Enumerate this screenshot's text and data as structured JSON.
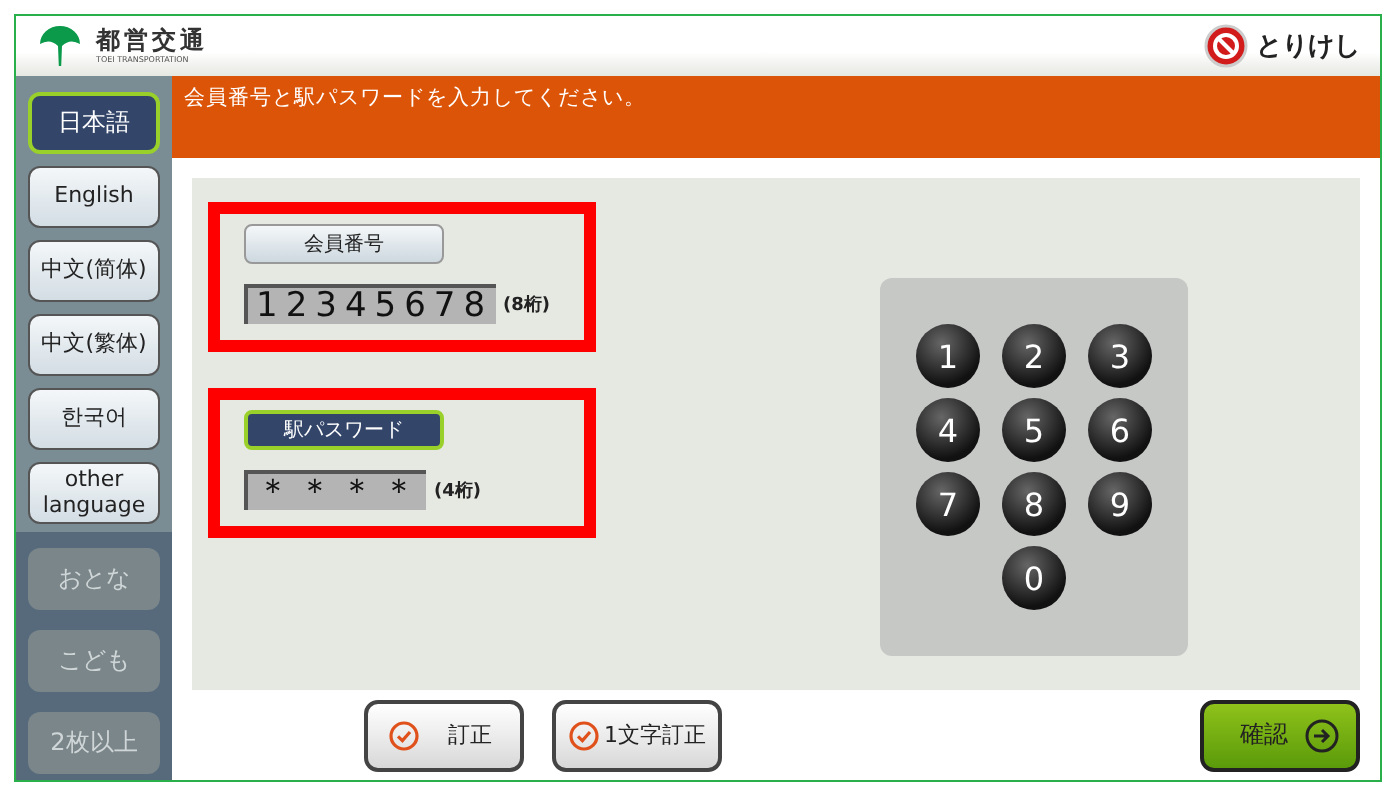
{
  "header": {
    "logo_title": "都営交通",
    "logo_subtitle": "TOEI TRANSPORTATION",
    "cancel_button": "とりけし"
  },
  "instruction": "会員番号と駅パスワードを入力してください。",
  "languages": [
    {
      "label": "日本語",
      "selected": true
    },
    {
      "label": "English",
      "selected": false
    },
    {
      "label": "中文(简体)",
      "selected": false
    },
    {
      "label": "中文(繁体)",
      "selected": false
    },
    {
      "label": "한국어",
      "selected": false
    },
    {
      "label": "other language",
      "selected": false
    }
  ],
  "ticket_types": [
    {
      "label": "おとな",
      "disabled": true
    },
    {
      "label": "こども",
      "disabled": true
    },
    {
      "label": "2枚以上",
      "disabled": true
    }
  ],
  "fields": [
    {
      "label": "会員番号",
      "value": "12345678",
      "hint": "(8桁)",
      "selected": false
    },
    {
      "label": "駅パスワード",
      "value": "＊＊＊＊",
      "hint": "(4桁)",
      "selected": true
    }
  ],
  "keypad": [
    "1",
    "2",
    "3",
    "4",
    "5",
    "6",
    "7",
    "8",
    "9",
    "0"
  ],
  "actions": [
    {
      "label": "訂正"
    },
    {
      "label": "1文字訂正"
    }
  ],
  "confirm_button": "確認"
}
